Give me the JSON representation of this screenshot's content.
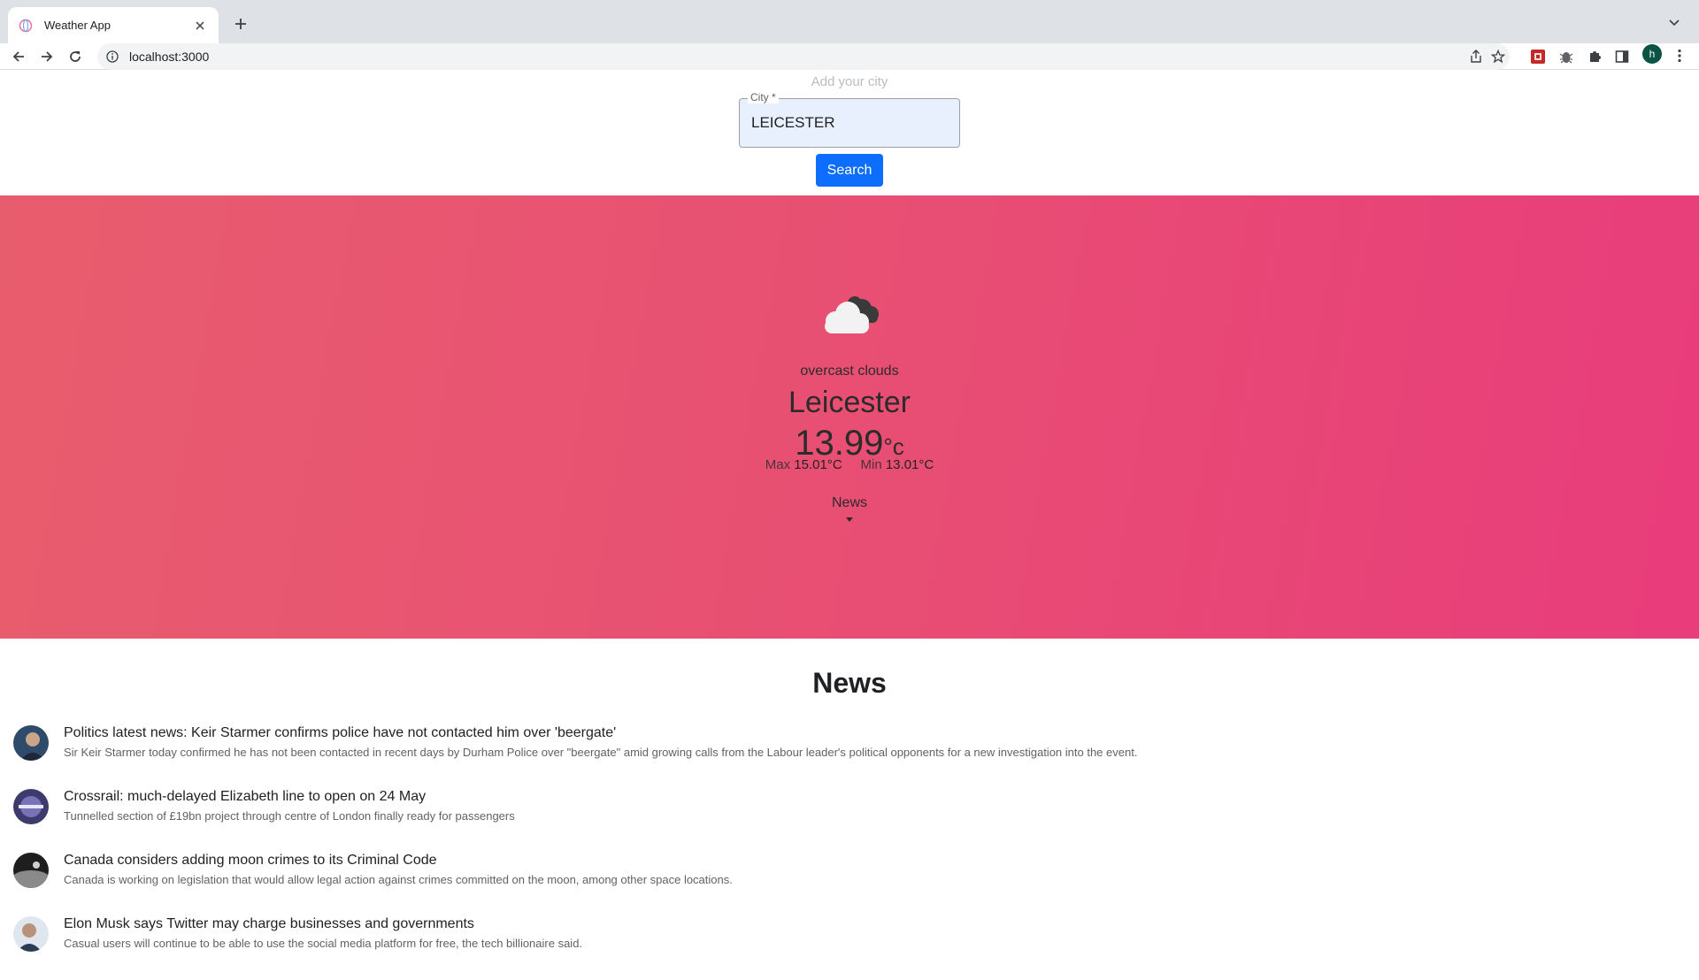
{
  "browser": {
    "tab_title": "Weather App",
    "url": "localhost:3000",
    "profile_initial": "h"
  },
  "search": {
    "heading": "Add your city",
    "field_label": "City *",
    "field_value": "LEICESTER",
    "button_label": "Search"
  },
  "weather": {
    "icon": "cloud-icon",
    "description": "overcast clouds",
    "city": "Leicester",
    "temperature": "13.99",
    "temp_unit": "°c",
    "max_label": "Max",
    "max_value": "15.01°C",
    "min_label": "Min",
    "min_value": "13.01°C",
    "news_toggle": "News"
  },
  "news": {
    "heading": "News",
    "items": [
      {
        "title": "Politics latest news: Keir Starmer confirms police have not contacted him over 'beergate'",
        "description": "Sir Keir Starmer today confirmed he has not been contacted in recent days by Durham Police over \"beergate\" amid growing calls from the Labour leader's political opponents for a new investigation into the event."
      },
      {
        "title": "Crossrail: much-delayed Elizabeth line to open on 24 May",
        "description": "Tunnelled section of £19bn project through centre of London finally ready for passengers"
      },
      {
        "title": "Canada considers adding moon crimes to its Criminal Code",
        "description": "Canada is working on legislation that would allow legal action against crimes committed on the moon, among other space locations."
      },
      {
        "title": "Elon Musk says Twitter may charge businesses and governments",
        "description": "Casual users will continue to be able to use the social media platform for free, the tech billionaire said."
      }
    ]
  },
  "colors": {
    "gradient_start": "#e85d6e",
    "gradient_end": "#e83c7b",
    "search_button": "#0d6efd"
  }
}
